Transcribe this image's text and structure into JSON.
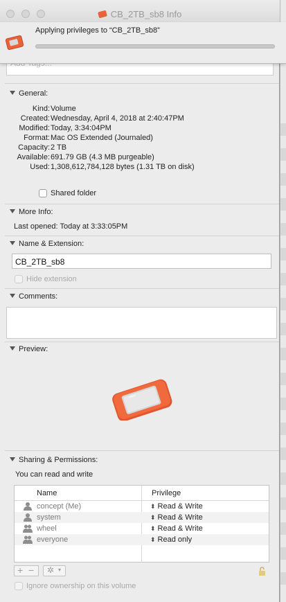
{
  "window": {
    "title": "CB_2TB_sb8 Info"
  },
  "sheet": {
    "text": "Applying privileges to “CB_2TB_sb8”",
    "progress": 0
  },
  "tags": {
    "placeholder": "Add Tags..."
  },
  "general": {
    "title": "General:",
    "rows": [
      {
        "label": "Kind:",
        "value": "Volume"
      },
      {
        "label": "Created:",
        "value": "Wednesday, April 4, 2018 at 2:40:47PM"
      },
      {
        "label": "Modified:",
        "value": "Today, 3:34:04PM"
      },
      {
        "label": "Format:",
        "value": "Mac OS Extended (Journaled)"
      },
      {
        "label": "Capacity:",
        "value": "2 TB"
      },
      {
        "label": "Available:",
        "value": "691.79 GB (4.3 MB purgeable)"
      },
      {
        "label": "Used:",
        "value": "1,308,612,784,128 bytes (1.31 TB on disk)"
      }
    ],
    "shared_folder_label": "Shared folder"
  },
  "more_info": {
    "title": "More Info:",
    "last_opened": "Last opened: Today at 3:33:05PM"
  },
  "name_extension": {
    "title": "Name & Extension:",
    "name": "CB_2TB_sb8",
    "hide_extension_label": "Hide extension"
  },
  "comments": {
    "title": "Comments:"
  },
  "preview": {
    "title": "Preview:"
  },
  "sharing": {
    "title": "Sharing & Permissions:",
    "summary": "You can read and write",
    "col_name": "Name",
    "col_privilege": "Privilege",
    "rows": [
      {
        "name": "concept (Me)",
        "privilege": "Read & Write",
        "icon": "user-icon"
      },
      {
        "name": "system",
        "privilege": "Read & Write",
        "icon": "user-icon"
      },
      {
        "name": "wheel",
        "privilege": "Read & Write",
        "icon": "group-icon"
      },
      {
        "name": "everyone",
        "privilege": "Read only",
        "icon": "group-icon"
      }
    ],
    "ignore_ownership_label": "Ignore ownership on this volume"
  },
  "colors": {
    "drive_orange": "#e8623a",
    "window_bg": "#ececec"
  }
}
